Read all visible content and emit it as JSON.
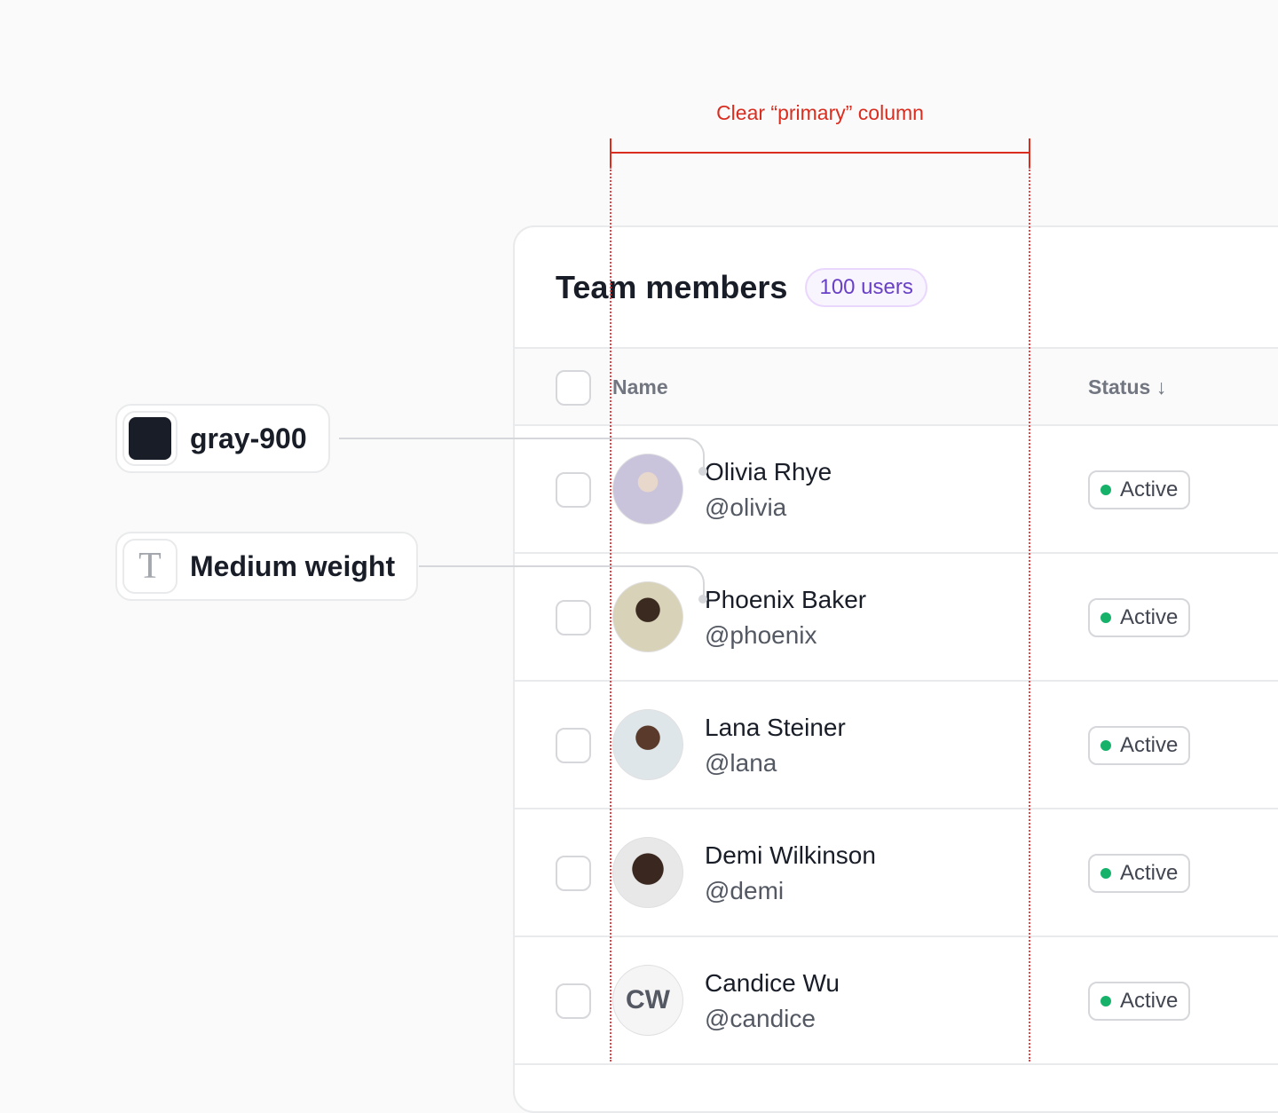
{
  "annotations": {
    "column_label": "Clear “primary” column",
    "color_tag": "gray-900",
    "weight_tag": "Medium weight",
    "color_hex": "#181d27",
    "accent": "#d92d20"
  },
  "card": {
    "title": "Team members",
    "badge": "100 users"
  },
  "table": {
    "headers": {
      "name": "Name",
      "status": "Status",
      "sort_icon": "arrow-down-icon"
    },
    "rows": [
      {
        "name": "Olivia Rhye",
        "handle": "@olivia",
        "status": "Active",
        "avatar": "photo"
      },
      {
        "name": "Phoenix Baker",
        "handle": "@phoenix",
        "status": "Active",
        "avatar": "photo"
      },
      {
        "name": "Lana Steiner",
        "handle": "@lana",
        "status": "Active",
        "avatar": "photo"
      },
      {
        "name": "Demi Wilkinson",
        "handle": "@demi",
        "status": "Active",
        "avatar": "photo"
      },
      {
        "name": "Candice Wu",
        "handle": "@candice",
        "status": "Active",
        "avatar": "initials",
        "initials": "CW"
      }
    ]
  }
}
